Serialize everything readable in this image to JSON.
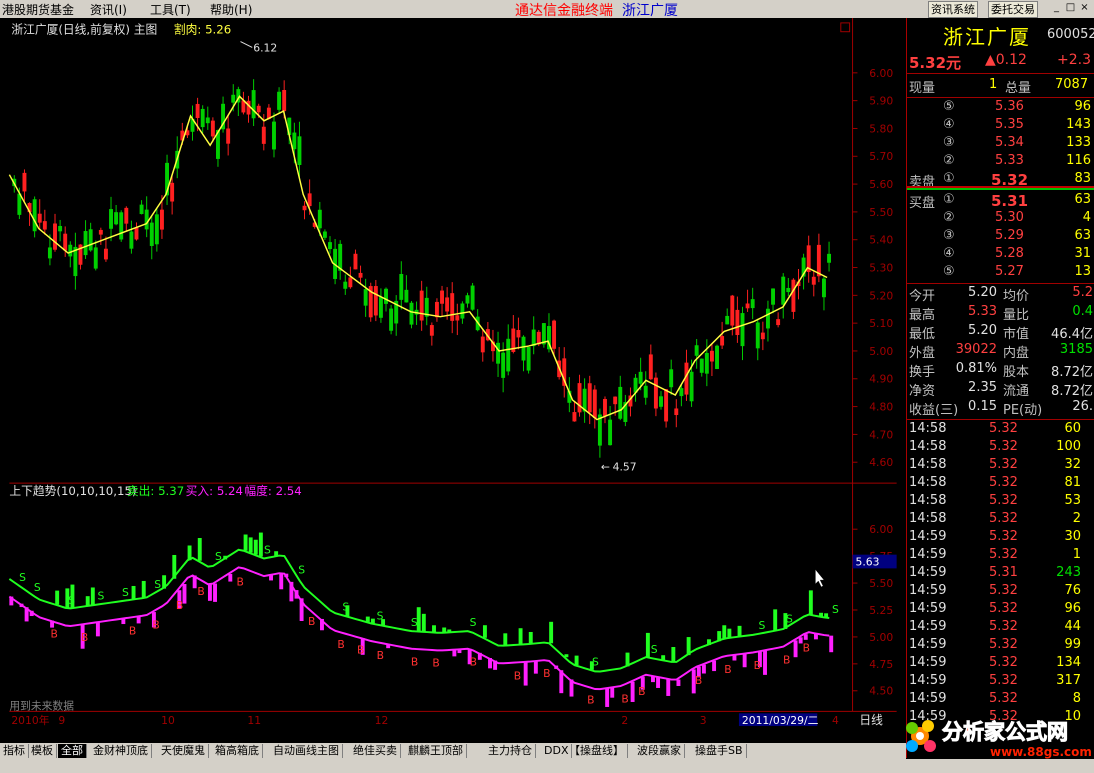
{
  "menu": {
    "items": [
      "港股期货基金",
      "资讯(I)",
      "工具(T)",
      "帮助(H)"
    ],
    "app_title": "通达信金融终端",
    "stock_title": "浙江广厦",
    "buttons": [
      "资讯系统",
      "委托交易"
    ]
  },
  "main_chart": {
    "header_name": "浙江广厦(日线,前复权) 主图",
    "header_value_label": "割肉: 5.26",
    "annot_high": "6.12",
    "annot_low": "4.57",
    "y_ticks": [
      "6.00",
      "5.90",
      "5.80",
      "5.70",
      "5.60",
      "5.50",
      "5.40",
      "5.30",
      "5.20",
      "5.10",
      "5.00",
      "4.90",
      "4.80",
      "4.70",
      "4.60"
    ]
  },
  "sub_chart": {
    "header_name": "上下趋势(10,10,10,15)",
    "sell": "卖出: 5.37",
    "buy": "买入: 5.24",
    "amp": "幅度: 2.54",
    "y_ticks": [
      "6.00",
      "5.75",
      "5.50",
      "5.25",
      "5.00",
      "4.75",
      "4.50"
    ],
    "cursor_price": "5.63",
    "footnote": "用到未来数据"
  },
  "time_axis": {
    "labels": [
      "2010年",
      "9",
      "10",
      "11",
      "12",
      "2",
      "3",
      "4"
    ],
    "cursor_date": "2011/03/29/二",
    "mode": "日线"
  },
  "quote": {
    "name": "浙江广厦",
    "code": "600052",
    "price": "5.32元",
    "change": "▲0.12",
    "change_pct": "+2.3",
    "xianliang_label": "现量",
    "xianliang": "1",
    "zongliang_label": "总量",
    "zongliang": "7087",
    "sell_label": "卖盘",
    "buy_label": "买盘",
    "asks": [
      {
        "lvl": "⑤",
        "price": "5.36",
        "vol": "96"
      },
      {
        "lvl": "④",
        "price": "5.35",
        "vol": "143"
      },
      {
        "lvl": "③",
        "price": "5.34",
        "vol": "133"
      },
      {
        "lvl": "②",
        "price": "5.33",
        "vol": "116"
      },
      {
        "lvl": "①",
        "price": "5.32",
        "vol": "83"
      }
    ],
    "bids": [
      {
        "lvl": "①",
        "price": "5.31",
        "vol": "63"
      },
      {
        "lvl": "②",
        "price": "5.30",
        "vol": "4"
      },
      {
        "lvl": "③",
        "price": "5.29",
        "vol": "63"
      },
      {
        "lvl": "④",
        "price": "5.28",
        "vol": "31"
      },
      {
        "lvl": "⑤",
        "price": "5.27",
        "vol": "13"
      }
    ],
    "stats": [
      {
        "l1": "今开",
        "v1": "5.20",
        "l2": "均价",
        "v2": "5.2"
      },
      {
        "l1": "最高",
        "v1": "5.33",
        "l2": "量比",
        "v2": "0.4"
      },
      {
        "l1": "最低",
        "v1": "5.20",
        "l2": "市值",
        "v2": "46.4亿"
      },
      {
        "l1": "外盘",
        "v1": "39022",
        "l2": "内盘",
        "v2": "3185"
      },
      {
        "l1": "换手",
        "v1": "0.81%",
        "l2": "股本",
        "v2": "8.72亿"
      },
      {
        "l1": "净资",
        "v1": "2.35",
        "l2": "流通",
        "v2": "8.72亿"
      },
      {
        "l1": "收益(三)",
        "v1": "0.15",
        "l2": "PE(动)",
        "v2": "26."
      }
    ],
    "ticks": [
      {
        "t": "14:58",
        "p": "5.32",
        "v": "60"
      },
      {
        "t": "14:58",
        "p": "5.32",
        "v": "100"
      },
      {
        "t": "14:58",
        "p": "5.32",
        "v": "32"
      },
      {
        "t": "14:58",
        "p": "5.32",
        "v": "81"
      },
      {
        "t": "14:58",
        "p": "5.32",
        "v": "53"
      },
      {
        "t": "14:58",
        "p": "5.32",
        "v": "2"
      },
      {
        "t": "14:59",
        "p": "5.32",
        "v": "30"
      },
      {
        "t": "14:59",
        "p": "5.32",
        "v": "1"
      },
      {
        "t": "14:59",
        "p": "5.31",
        "v": "243"
      },
      {
        "t": "14:59",
        "p": "5.32",
        "v": "76"
      },
      {
        "t": "14:59",
        "p": "5.32",
        "v": "96"
      },
      {
        "t": "14:59",
        "p": "5.32",
        "v": "44"
      },
      {
        "t": "14:59",
        "p": "5.32",
        "v": "99"
      },
      {
        "t": "14:59",
        "p": "5.32",
        "v": "134"
      },
      {
        "t": "14:59",
        "p": "5.32",
        "v": "317"
      },
      {
        "t": "14:59",
        "p": "5.32",
        "v": "8"
      },
      {
        "t": "14:59",
        "p": "5.32",
        "v": "10"
      }
    ]
  },
  "tabs": [
    "指标",
    "模板",
    "全部",
    "金财神顶底",
    "天使魔鬼",
    "箱高箱底",
    "自动画线主图",
    "绝佳买卖",
    "麒麟王顶部",
    "主力持仓",
    "DDX",
    "【操盘线】",
    "波段赢家",
    "操盘手SB"
  ],
  "logo": {
    "text": "分析家公式网",
    "url": "www.88gs.com"
  },
  "colors": {
    "up": "#ff2020",
    "down": "#00d000",
    "ma": "#ffff40",
    "upper": "#20ff20",
    "lower": "#ff20ff",
    "axis": "#a00000"
  }
}
